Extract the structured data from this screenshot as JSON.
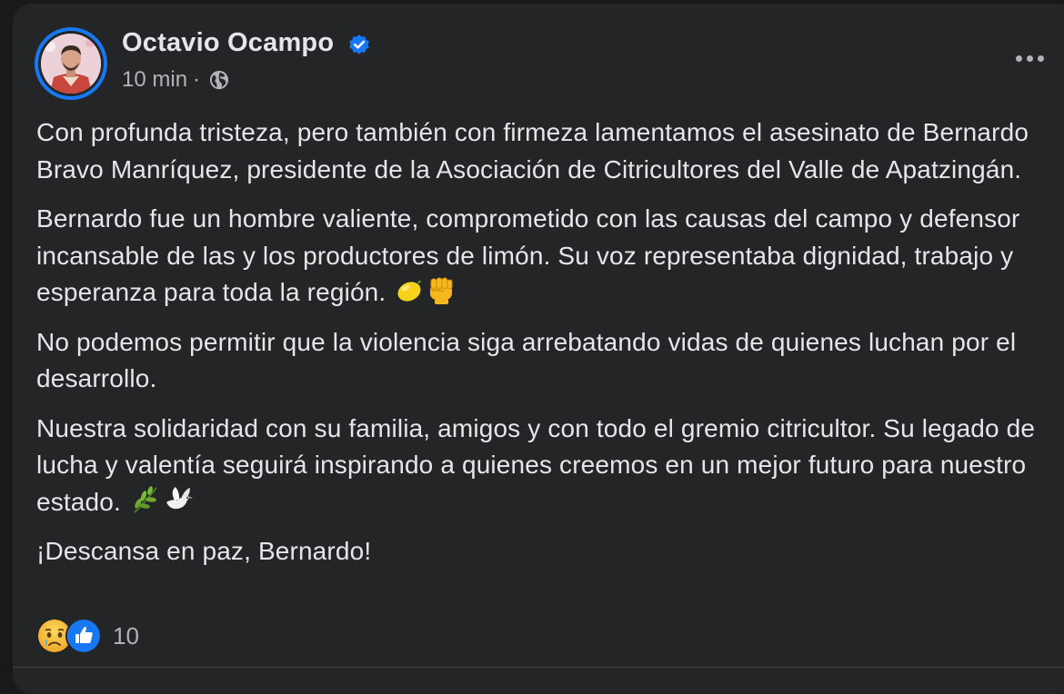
{
  "post": {
    "author": "Octavio Ocampo",
    "time": "10 min",
    "separator": "·",
    "privacy_icon": "globe-icon",
    "verified_icon": "verified-badge-icon",
    "more_icon": "more-options-icon"
  },
  "content": {
    "p1": "Con profunda tristeza, pero también con firmeza lamentamos el asesinato de Bernardo Bravo Manríquez, presidente de la Asociación de Citricultores del Valle de Apatzingán.",
    "p2": "Bernardo fue un hombre valiente, comprometido con las causas del campo y defensor incansable de las y los productores de limón. Su voz representaba dignidad, trabajo y esperanza para toda la región.",
    "p3": "No podemos permitir que la violencia siga arrebatando vidas de quienes luchan por el desarrollo.",
    "p4": "Nuestra solidaridad con su familia, amigos y con todo el gremio citricultor. Su legado de lucha y valentía seguirá inspirando a quienes creemos en un mejor futuro para nuestro estado.",
    "p5": "¡Descansa en paz, Bernardo!",
    "p2_emojis": [
      "lemon-emoji",
      "raised-fist-emoji"
    ],
    "p4_emojis": [
      "herb-emoji",
      "dove-emoji"
    ]
  },
  "reactions": {
    "icons": [
      "sad-reaction-icon",
      "like-reaction-icon"
    ],
    "count": "10"
  },
  "colors": {
    "background": "#242526",
    "text": "#e4e6eb",
    "secondary_text": "#b0b3b8",
    "accent": "#1877f2"
  }
}
